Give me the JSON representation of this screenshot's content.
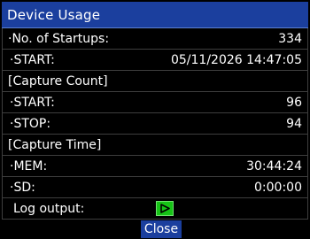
{
  "title": "Device Usage",
  "rows": {
    "startups": {
      "label": "·No. of Startups:",
      "value": "334"
    },
    "startups_start": {
      "label": "·START:",
      "value": "05/11/2026 14:47:05"
    },
    "capture_count_header": "[Capture Count]",
    "capture_count_start": {
      "label": "·START:",
      "value": "96"
    },
    "capture_count_stop": {
      "label": "·STOP:",
      "value": "94"
    },
    "capture_time_header": "[Capture Time]",
    "capture_time_mem": {
      "label": "·MEM:",
      "value": "30:44:24"
    },
    "capture_time_sd": {
      "label": "·SD:",
      "value": "0:00:00"
    },
    "log_output": {
      "label": "Log output:",
      "icon": "play-icon"
    }
  },
  "close_label": "Close",
  "colors": {
    "title_bg": "#1b3f9e",
    "background": "#000000",
    "play_button": "#16c316",
    "divider": "#3e3e3e"
  }
}
